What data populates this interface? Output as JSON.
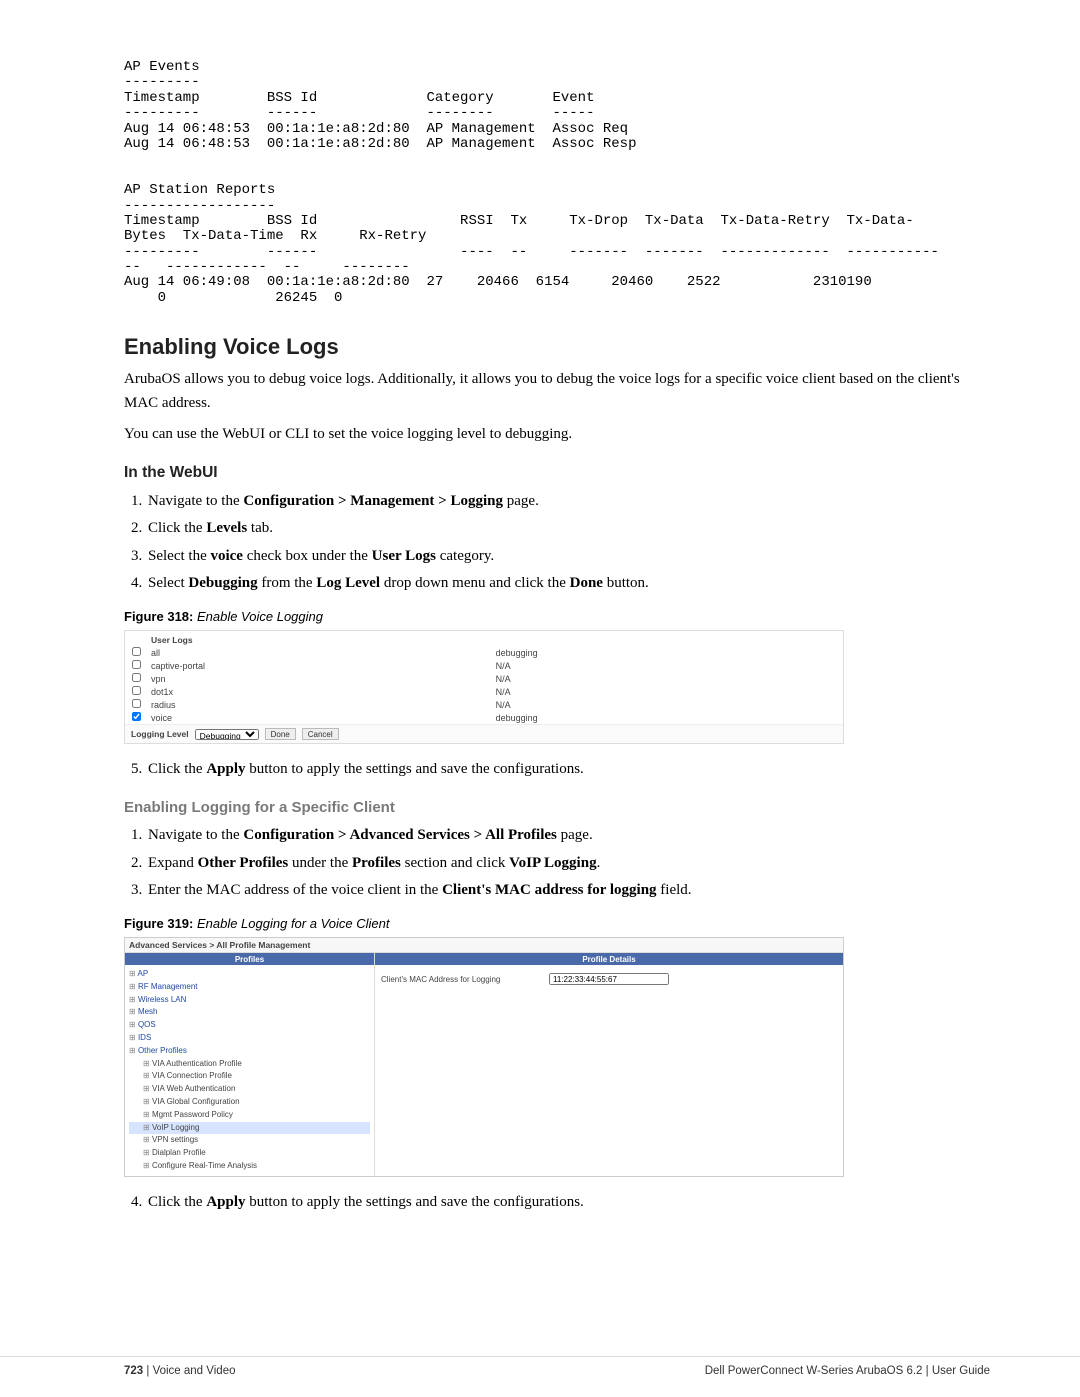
{
  "codeblock": "AP Events\n---------\nTimestamp        BSS Id             Category       Event\n---------        ------             --------       -----\nAug 14 06:48:53  00:1a:1e:a8:2d:80  AP Management  Assoc Req\nAug 14 06:48:53  00:1a:1e:a8:2d:80  AP Management  Assoc Resp\n\n\nAP Station Reports\n------------------\nTimestamp        BSS Id                 RSSI  Tx     Tx-Drop  Tx-Data  Tx-Data-Retry  Tx-Data-\nBytes  Tx-Data-Time  Rx     Rx-Retry\n---------        ------                 ----  --     -------  -------  -------------  -----------\n--   ------------  --     --------\nAug 14 06:49:08  00:1a:1e:a8:2d:80  27    20466  6154     20460    2522           2310190\n    0             26245  0",
  "section1": {
    "title": "Enabling Voice Logs",
    "para1": "ArubaOS allows you to debug voice logs. Additionally, it allows you to debug the voice logs for a specific voice client based on the client's MAC address.",
    "para2": "You can use the WebUI or CLI to set the voice logging level to debugging."
  },
  "webui_title": "In the WebUI",
  "webui_steps": {
    "s1_pre": "Navigate to the ",
    "s1_bold": "Configuration > Management > Logging",
    "s1_post": " page.",
    "s2_pre": "Click the ",
    "s2_bold": "Levels",
    "s2_post": " tab.",
    "s3_pre": "Select the ",
    "s3_b1": "voice",
    "s3_mid": " check box under the ",
    "s3_b2": "User Logs",
    "s3_post": " category.",
    "s4_pre": "Select ",
    "s4_b1": "Debugging",
    "s4_mid1": " from the ",
    "s4_b2": "Log Level",
    "s4_mid2": " drop down menu and click the ",
    "s4_b3": "Done",
    "s4_post": " button."
  },
  "fig318": {
    "caption_bold": "Figure 318:",
    "caption_italic": " Enable Voice Logging",
    "header_userlogs": "User Logs",
    "header_level": "",
    "rows": [
      {
        "chk": false,
        "name": "all",
        "level": "debugging"
      },
      {
        "chk": false,
        "name": "captive-portal",
        "level": "N/A"
      },
      {
        "chk": false,
        "name": "vpn",
        "level": "N/A"
      },
      {
        "chk": false,
        "name": "dot1x",
        "level": "N/A"
      },
      {
        "chk": false,
        "name": "radius",
        "level": "N/A"
      },
      {
        "chk": true,
        "name": "voice",
        "level": "debugging"
      }
    ],
    "bottom_label": "Logging Level",
    "bottom_select": "Debugging",
    "btn_done": "Done",
    "btn_cancel": "Cancel"
  },
  "afterfig318": {
    "s5_pre": "Click the ",
    "s5_b": "Apply",
    "s5_post": " button to apply the settings and save the configurations."
  },
  "spec_title": "Enabling Logging for a Specific Client",
  "spec_steps": {
    "s1_pre": "Navigate to the ",
    "s1_b": "Configuration > Advanced Services > All Profiles",
    "s1_post": " page.",
    "s2_pre": "Expand ",
    "s2_b1": "Other Profiles",
    "s2_mid": " under the ",
    "s2_b2": "Profiles",
    "s2_mid2": " section and click ",
    "s2_b3": "VoIP Logging",
    "s2_post": ".",
    "s3_pre": "Enter the MAC address of the voice client in the ",
    "s3_b": "Client's MAC address for logging",
    "s3_post": " field."
  },
  "fig319": {
    "caption_bold": "Figure 319:",
    "caption_italic": " Enable Logging for a Voice Client",
    "breadcrumb": "Advanced Services > All Profile Management",
    "profiles_header": "Profiles",
    "details_header": "Profile Details",
    "tree_top": [
      "AP",
      "RF Management",
      "Wireless LAN",
      "Mesh",
      "QOS",
      "IDS"
    ],
    "tree_other": "Other Profiles",
    "tree_children": [
      "VIA Authentication Profile",
      "VIA Connection Profile",
      "VIA Web Authentication",
      "VIA Global Configuration",
      "Mgmt Password Policy",
      "VoIP Logging",
      "VPN settings",
      "Dialplan Profile",
      "Configure Real-Time Analysis"
    ],
    "detail_label": "Client's MAC Address for Logging",
    "detail_value": "11:22:33:44:55:67"
  },
  "afterfig319": {
    "s4_pre": "Click the ",
    "s4_b": "Apply",
    "s4_post": " button to apply the settings and save the configurations."
  },
  "footer": {
    "page": "723",
    "left_rest": " | Voice and Video",
    "right": "Dell PowerConnect W-Series ArubaOS 6.2  |  User Guide"
  }
}
